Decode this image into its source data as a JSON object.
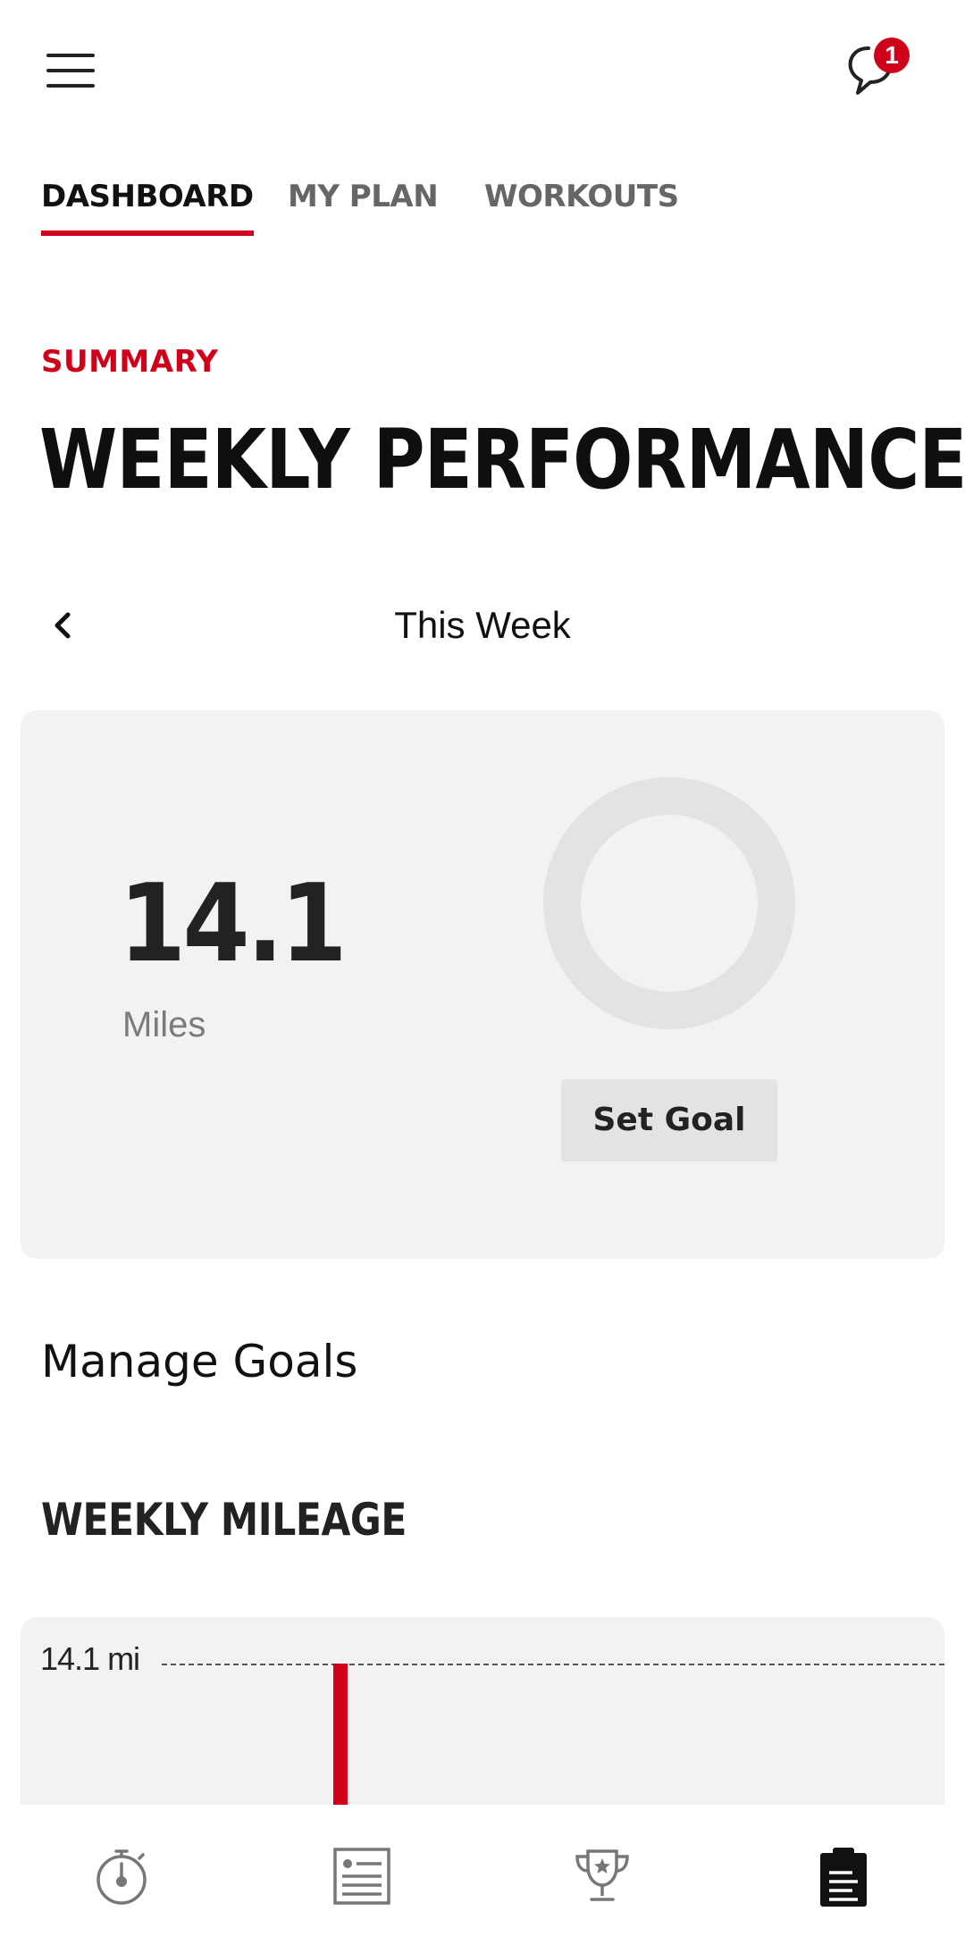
{
  "header": {
    "notification_count": "1"
  },
  "tabs": [
    {
      "label": "DASHBOARD",
      "active": true
    },
    {
      "label": "MY PLAN",
      "active": false
    },
    {
      "label": "WORKOUTS",
      "active": false
    }
  ],
  "summary": {
    "eyebrow": "SUMMARY",
    "title": "WEEKLY PERFORMANCE"
  },
  "week_nav": {
    "label": "This Week"
  },
  "stats": {
    "miles_value": "14.1",
    "miles_unit": "Miles",
    "set_goal_label": "Set Goal"
  },
  "goals": {
    "manage_label": "Manage Goals"
  },
  "mileage": {
    "title": "WEEKLY MILEAGE"
  },
  "chart_data": {
    "type": "bar",
    "max_label": "14.1 mi",
    "reference_value": 14.1,
    "bars": [
      {
        "value": 14.1
      }
    ],
    "colors": {
      "bar": "#d0021b"
    }
  },
  "bottom_nav": [
    {
      "icon": "stopwatch-icon",
      "active": false
    },
    {
      "icon": "list-icon",
      "active": false
    },
    {
      "icon": "trophy-icon",
      "active": false
    },
    {
      "icon": "clipboard-icon",
      "active": true
    }
  ],
  "colors": {
    "accent": "#d0021b",
    "card_bg": "#f2f2f2",
    "ring": "#e3e3e5"
  }
}
